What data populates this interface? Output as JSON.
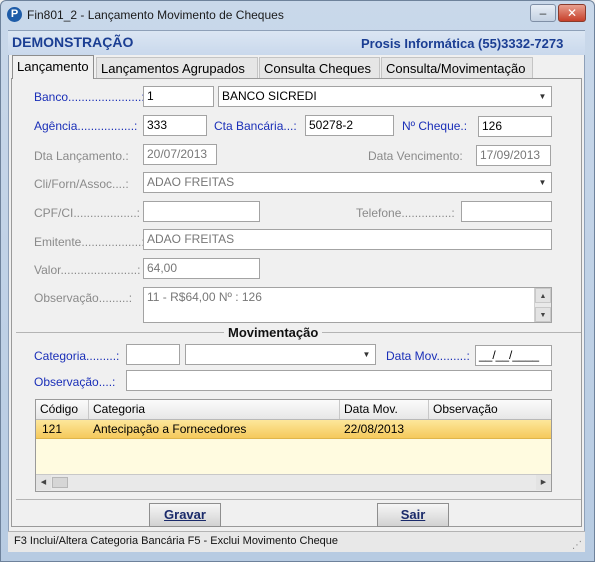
{
  "window": {
    "title": "Fin801_2 - Lançamento Movimento de Cheques",
    "app_icon_letter": "P",
    "minimize": "–",
    "maximize": "□",
    "close": "✕"
  },
  "header": {
    "company": "DEMONSTRAÇÃO",
    "vendor": "Prosis Informática (55)3332-7273"
  },
  "tabs": [
    {
      "label": "Lançamento",
      "active": true
    },
    {
      "label": "Lançamentos Agrupados",
      "active": false
    },
    {
      "label": "Consulta Cheques",
      "active": false
    },
    {
      "label": "Consulta/Movimentação",
      "active": false
    }
  ],
  "form": {
    "banco": {
      "label": "Banco......................:",
      "code": "1",
      "name": "BANCO SICREDI"
    },
    "agencia": {
      "label": "Agência.................:",
      "value": "333"
    },
    "cta_bancaria": {
      "label": "Cta Bancária...:",
      "value": "50278-2"
    },
    "num_cheque": {
      "label": "Nº Cheque.:",
      "value": "126"
    },
    "dta_lancamento": {
      "label": "Dta Lançamento.:",
      "value": "20/07/2013"
    },
    "data_vencimento": {
      "label": "Data Vencimento:",
      "value": "17/09/2013"
    },
    "cli_forn": {
      "label": "Cli/Forn/Assoc....:",
      "value": "ADAO FREITAS"
    },
    "cpf": {
      "label": "CPF/CI...................:",
      "value": ""
    },
    "telefone": {
      "label": "Telefone...............:",
      "value": ""
    },
    "emitente": {
      "label": "Emitente..................:",
      "value": "ADAO FREITAS"
    },
    "valor": {
      "label": "Valor.......................:",
      "value": "64,00"
    },
    "observacao": {
      "label": "Observação.........:",
      "value": "11 - R$64,00 Nº : 126"
    }
  },
  "movimentacao": {
    "title": "Movimentação",
    "categoria_label": "Categoria.........:",
    "categoria_code": "",
    "categoria_value": "",
    "data_mov_label": "Data Mov.........:",
    "data_mov_value": "__/__/____",
    "observacao_label": "Observação....:",
    "observacao_value": ""
  },
  "grid": {
    "columns": [
      "Código",
      "Categoria",
      "Data Mov.",
      "Observação"
    ],
    "rows": [
      {
        "codigo": "121",
        "categoria": "Antecipação a Fornecedores",
        "data_mov": "22/08/2013",
        "observacao": ""
      }
    ]
  },
  "buttons": {
    "gravar": "Gravar",
    "sair": "Sair"
  },
  "status": {
    "text": "F3 Inclui/Altera Categoria Bancária    F5 - Exclui Movimento Cheque"
  },
  "colors": {
    "label_blue": "#1a2fb8",
    "header_blue": "#1b3e93",
    "row_highlight": "#f5c95c"
  }
}
